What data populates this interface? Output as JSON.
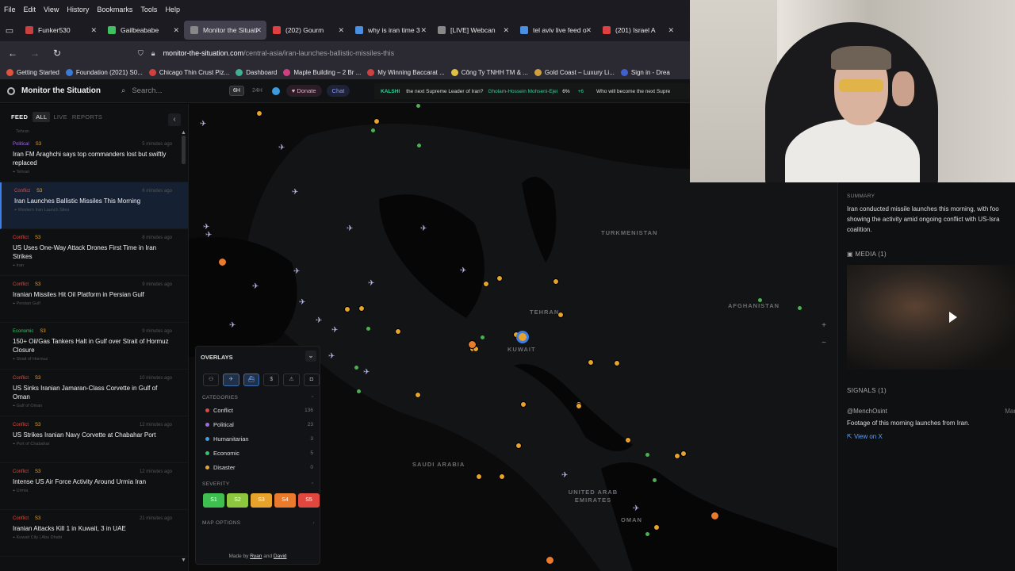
{
  "browser": {
    "menu": [
      "File",
      "Edit",
      "View",
      "History",
      "Bookmarks",
      "Tools",
      "Help"
    ],
    "tabs": [
      {
        "label": "Funker530",
        "color": "#c94040"
      },
      {
        "label": "Gailbeababe",
        "color": "#40c060"
      },
      {
        "label": "Monitor the Situati",
        "color": "#888888"
      },
      {
        "label": "(202) Gourm",
        "color": "#e04040"
      },
      {
        "label": "why is iran time 3",
        "color": "#4a90e2"
      },
      {
        "label": "[LIVE] Webcan",
        "color": "#888888"
      },
      {
        "label": "tel aviv live feed o",
        "color": "#4a90e2"
      },
      {
        "label": "(201) Israel A",
        "color": "#e04040"
      }
    ],
    "url_host": "monitor-the-situation.com",
    "url_path": "/central-asia/iran-launches-ballistic-missiles-this",
    "bookmarks": [
      {
        "label": "Getting Started",
        "color": "#e0533c"
      },
      {
        "label": "Foundation (2021) S0...",
        "color": "#3a7bd5"
      },
      {
        "label": "Chicago Thin Crust Piz...",
        "color": "#d04040"
      },
      {
        "label": "Dashboard",
        "color": "#40b090"
      },
      {
        "label": "Maple Building – 2 Br ...",
        "color": "#d04080"
      },
      {
        "label": "My Winning Baccarat ...",
        "color": "#d04040"
      },
      {
        "label": "Công Ty TNHH TM & ...",
        "color": "#e0c040"
      },
      {
        "label": "Gold Coast – Luxury Li...",
        "color": "#d0a040"
      },
      {
        "label": "Sign in - Drea",
        "color": "#4060d0"
      }
    ]
  },
  "app": {
    "title": "Monitor the Situation",
    "search_placeholder": "Search...",
    "range_on": "6H",
    "range_off": "24H",
    "donate": "♥ Donate",
    "chat": "Chat",
    "ticker": {
      "brand": "KALSHI",
      "q1": "the next Supreme Leader of Iran?",
      "name": "Gholam-Hossein Mohseni-Ejei",
      "pct": "6%",
      "delta": "+6",
      "q2": "Who will become the next Supre"
    }
  },
  "feed": {
    "label": "FEED",
    "tabs": [
      "ALL",
      "LIVE",
      "REPORTS"
    ],
    "top_loc": "Tehran",
    "items": [
      {
        "cat": "Political",
        "catColor": "#9d6be8",
        "sev": "S3",
        "ago": "5 minutes ago",
        "title": "Iran FM Araghchi says top commanders lost but swiftly replaced",
        "loc": "Tehran"
      },
      {
        "cat": "Conflict",
        "catColor": "#e0483f",
        "sev": "S3",
        "ago": "6 minutes ago",
        "title": "Iran Launches Ballistic Missiles This Morning",
        "loc": "Western Iran Launch Sites"
      },
      {
        "cat": "Conflict",
        "catColor": "#e0483f",
        "sev": "S3",
        "ago": "8 minutes ago",
        "title": "US Uses One-Way Attack Drones First Time in Iran Strikes",
        "loc": "Iran"
      },
      {
        "cat": "Conflict",
        "catColor": "#e0483f",
        "sev": "S3",
        "ago": "9 minutes ago",
        "title": "Iranian Missiles Hit Oil Platform in Persian Gulf",
        "loc": "Persian Gulf"
      },
      {
        "cat": "Economic",
        "catColor": "#36c36a",
        "sev": "S3",
        "ago": "9 minutes ago",
        "title": "150+ Oil/Gas Tankers Halt in Gulf over Strait of Hormuz Closure",
        "loc": "Strait of Hormuz"
      },
      {
        "cat": "Conflict",
        "catColor": "#e0483f",
        "sev": "S3",
        "ago": "10 minutes ago",
        "title": "US Sinks Iranian Jamaran-Class Corvette in Gulf of Oman",
        "loc": "Gulf of Oman"
      },
      {
        "cat": "Conflict",
        "catColor": "#e0483f",
        "sev": "S3",
        "ago": "12 minutes ago",
        "title": "US Strikes Iranian Navy Corvette at Chabahar Port",
        "loc": "Port of Chabahar"
      },
      {
        "cat": "Conflict",
        "catColor": "#e0483f",
        "sev": "S3",
        "ago": "12 minutes ago",
        "title": "Intense US Air Force Activity Around Urmia Iran",
        "loc": "Urmia"
      },
      {
        "cat": "Conflict",
        "catColor": "#e0483f",
        "sev": "S3",
        "ago": "21 minutes ago",
        "title": "Iranian Attacks Kill 1 in Kuwait, 3 in UAE",
        "loc": "Kuwait City | Abu Dhabi"
      }
    ]
  },
  "map": {
    "labels": [
      {
        "text": "TURKMENISTAN"
      },
      {
        "text": "TEHRAN"
      },
      {
        "text": "AFGHANISTAN"
      },
      {
        "text": "KUWAIT"
      },
      {
        "text": "SAUDI ARABIA"
      },
      {
        "text": "UNITED ARAB EMIRATES"
      },
      {
        "text": "OMAN"
      }
    ]
  },
  "overlays": {
    "title": "OVERLAYS",
    "categories_label": "CATEGORIES",
    "categories": [
      {
        "name": "Conflict",
        "count": "136",
        "color": "#e0483f"
      },
      {
        "name": "Political",
        "count": "23",
        "color": "#9d6be8"
      },
      {
        "name": "Humanitarian",
        "count": "3",
        "color": "#3fa0e0"
      },
      {
        "name": "Economic",
        "count": "5",
        "color": "#36c36a"
      },
      {
        "name": "Disaster",
        "count": "0",
        "color": "#e7a534"
      }
    ],
    "severity_label": "SEVERITY",
    "severity": [
      {
        "label": "S1",
        "color": "#3fbf4f"
      },
      {
        "label": "S2",
        "color": "#8dc63f"
      },
      {
        "label": "S3",
        "color": "#e8a32c"
      },
      {
        "label": "S4",
        "color": "#ea7a2c"
      },
      {
        "label": "S5",
        "color": "#e0483f"
      }
    ],
    "map_options_label": "MAP OPTIONS",
    "made_by": "Made by",
    "author1": "Ryan",
    "and": "and",
    "author2": "David"
  },
  "detail": {
    "summary_label": "SUMMARY",
    "summary": "Iran conducted missile launches this morning, with foo showing the activity amid ongoing conflict with US-Isra coalition.",
    "media_label": "MEDIA (1)",
    "signals_label": "SIGNALS (1)",
    "signal_source": "@MenchOsint",
    "signal_date": "Mar",
    "signal_text": "Footage of this morning launches from Iran.",
    "view_x": "View on X"
  }
}
